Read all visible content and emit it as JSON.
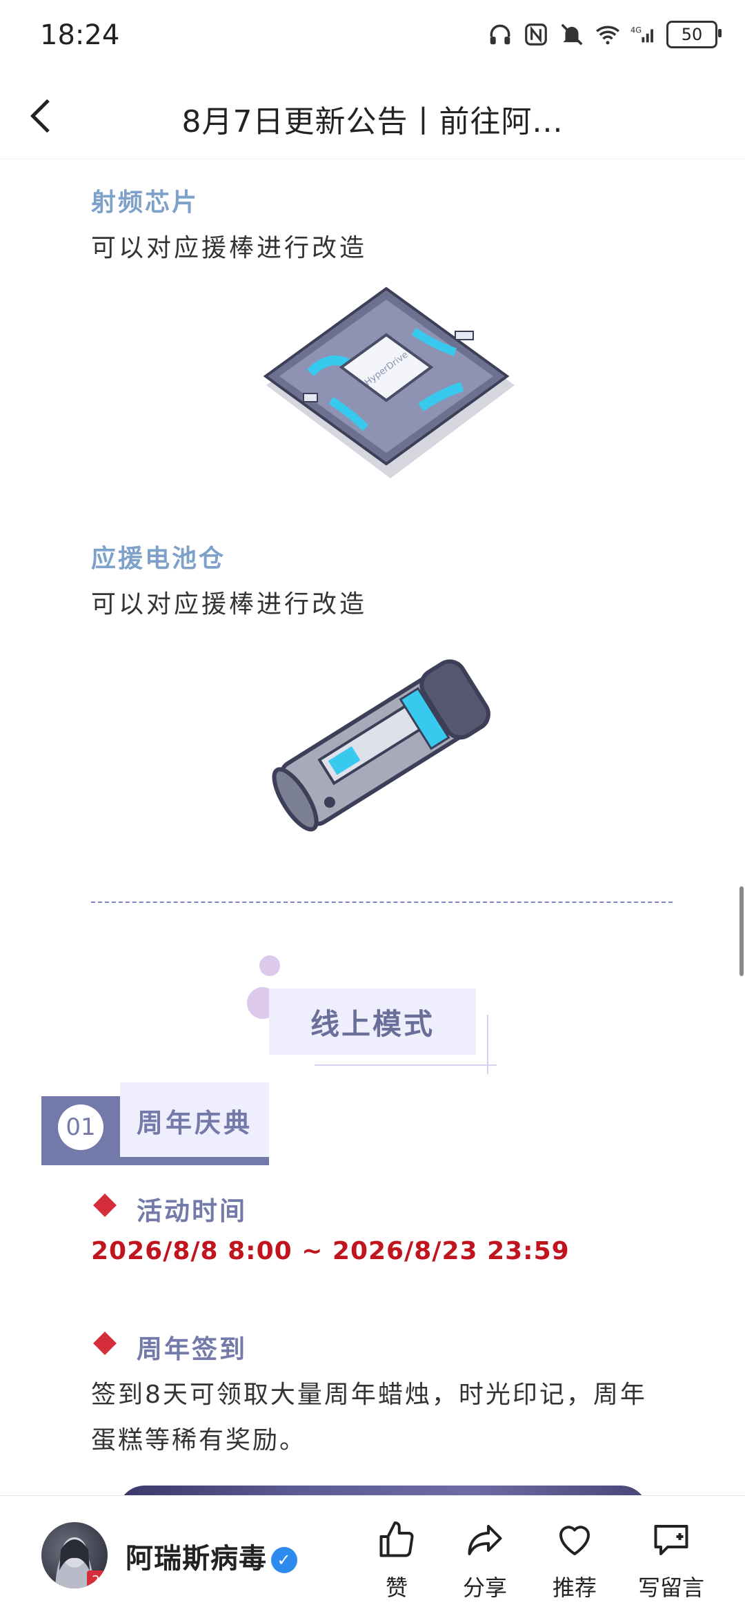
{
  "status": {
    "time": "18:24",
    "battery": "50",
    "network": "4G"
  },
  "nav": {
    "title": "8月7日更新公告丨前往阿..."
  },
  "items": [
    {
      "title": "射频芯片",
      "desc": "可以对应援棒进行改造",
      "chip_text": "HyperDrive"
    },
    {
      "title": "应援电池仓",
      "desc": "可以对应援棒进行改造"
    }
  ],
  "mode": {
    "label": "线上模式"
  },
  "section": {
    "number": "01",
    "title": "周年庆典",
    "time_heading": "活动时间",
    "time_value": "2026/8/8 8:00 ~ 2026/8/23 23:59",
    "checkin_heading": "周年签到",
    "checkin_text": "签到8天可领取大量周年蜡烛，时光印记，周年蛋糕等稀有奖励。"
  },
  "bottom": {
    "author": "阿瑞斯病毒",
    "avatar_badge": "2",
    "actions": {
      "like": "赞",
      "share": "分享",
      "recommend": "推荐",
      "comment": "写留言"
    }
  },
  "colors": {
    "accent": "#7379a8",
    "date_red": "#c0141f",
    "item_title": "#7da1c9"
  }
}
